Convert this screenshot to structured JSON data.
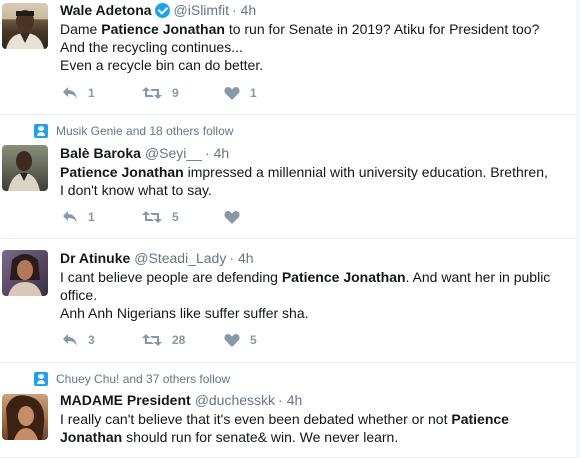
{
  "tweets": [
    {
      "social": "",
      "name": "Wale Adetona",
      "verified": true,
      "handle": "@iSlimfit",
      "time": "4h",
      "lines": [
        [
          [
            "Dame ",
            false
          ],
          [
            "Patience Jonathan",
            true
          ],
          [
            " to run for Senate in 2019? Atiku for President too?",
            false
          ]
        ],
        [
          [
            "And the recycling continues...",
            false
          ]
        ],
        [
          [
            "Even a recycle bin can do better.",
            false
          ]
        ]
      ],
      "replies": "1",
      "retweets": "9",
      "likes": "1"
    },
    {
      "social": "Musik Genie and 18 others follow",
      "name": "Balè Baroka",
      "verified": false,
      "handle": "@Seyi__",
      "time": "4h",
      "lines": [
        [
          [
            "Patience Jonathan",
            true
          ],
          [
            " impressed a millennial with university education. Brethren,",
            false
          ]
        ],
        [
          [
            "I don't know what to say.",
            false
          ]
        ]
      ],
      "replies": "1",
      "retweets": "5",
      "likes": ""
    },
    {
      "social": "",
      "name": "Dr Atinuke",
      "verified": false,
      "handle": "@Steadi_Lady",
      "time": "4h",
      "lines": [
        [
          [
            "I cant believe people are defending ",
            false
          ],
          [
            "Patience Jonathan",
            true
          ],
          [
            ". And want her in public",
            false
          ]
        ],
        [
          [
            "office.",
            false
          ]
        ],
        [
          [
            "Anh Anh Nigerians like suffer suffer sha.",
            false
          ]
        ]
      ],
      "replies": "3",
      "retweets": "28",
      "likes": "5"
    },
    {
      "social": "Chuey Chu! and 37 others follow",
      "name": "MADAME President",
      "verified": false,
      "handle": "@duchesskk",
      "time": "4h",
      "lines": [
        [
          [
            "I really can't believe that it's even been debated whether or not ",
            false
          ],
          [
            "Patience",
            true
          ]
        ],
        [
          [
            "Jonathan",
            true
          ],
          [
            " should run for senate& win. We never learn.",
            false
          ]
        ]
      ],
      "replies": "",
      "retweets": "",
      "likes": ""
    }
  ],
  "colors": {
    "accent": "#1da1f2",
    "meta": "#657786",
    "action": "#8899a6"
  },
  "icons": {
    "reply": "reply-icon",
    "retweet": "retweet-icon",
    "like": "heart-icon",
    "social": "person-follow-icon",
    "verified": "verified-badge-icon"
  }
}
